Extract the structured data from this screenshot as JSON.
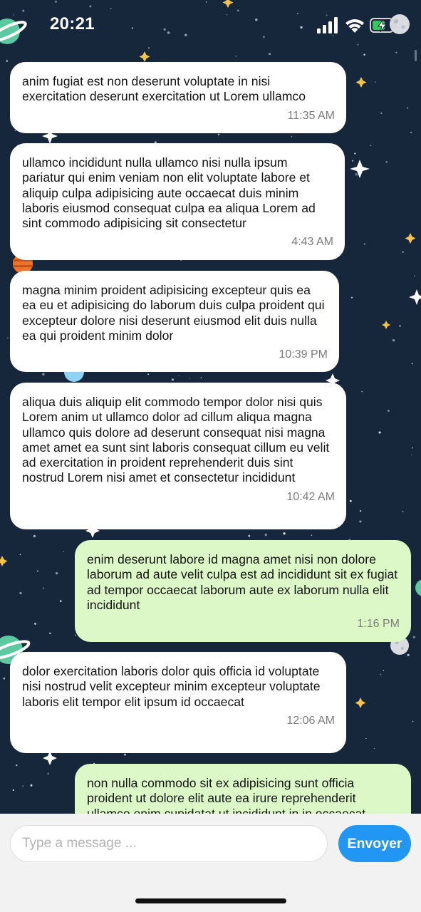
{
  "status_bar": {
    "time": "20:21",
    "icons": [
      "signal-icon",
      "wifi-icon",
      "battery-charging-icon"
    ]
  },
  "chat": {
    "messages": [
      {
        "direction": "received",
        "text": "anim fugiat est non deserunt voluptate in nisi exercitation deserunt exercitation ut Lorem ullamco",
        "time": "11:35 AM"
      },
      {
        "direction": "received",
        "text": "ullamco incididunt nulla ullamco nisi nulla ipsum pariatur qui enim veniam non elit voluptate labore et aliquip culpa adipisicing aute occaecat duis minim laboris eiusmod consequat culpa ea aliqua Lorem ad sint commodo adipisicing sit consectetur",
        "time": "4:43 AM"
      },
      {
        "direction": "received",
        "text": "magna minim proident adipisicing excepteur quis ea ea eu et adipisicing do laborum duis culpa proident qui excepteur dolore nisi deserunt eiusmod elit duis nulla ea qui proident minim dolor",
        "time": "10:39 PM"
      },
      {
        "direction": "received",
        "text": "aliqua duis aliquip elit commodo tempor dolor nisi quis Lorem anim ut ullamco dolor ad cillum aliqua magna ullamco quis dolore ad deserunt consequat nisi magna amet amet ea sunt sint laboris consequat cillum eu velit ad exercitation in proident reprehenderit duis sint nostrud Lorem nisi amet et consectetur incididunt",
        "time": "10:42 AM"
      },
      {
        "direction": "sent",
        "text": "enim deserunt labore id magna amet nisi non dolore laborum ad aute velit culpa est ad incididunt sit ex fugiat ad tempor occaecat laborum aute ex laborum nulla elit incididunt",
        "time": "1:16 PM"
      },
      {
        "direction": "received",
        "text": "dolor exercitation laboris dolor quis officia id voluptate nisi nostrud velit excepteur minim excepteur voluptate laboris elit tempor elit ipsum id occaecat",
        "time": "12:06 AM"
      },
      {
        "direction": "sent",
        "text": "non nulla commodo sit ex adipisicing sunt officia proident ut dolore elit aute ea irure reprehenderit ullamco enim cupidatat ut incididunt in in occaecat",
        "time": ""
      }
    ]
  },
  "composer": {
    "placeholder": "Type a message ...",
    "value": "",
    "send_label": "Envoyer"
  },
  "colors": {
    "background": "#16263b",
    "received_bubble": "#ffffff",
    "sent_bubble": "#dcf8c6",
    "send_button": "#2196f3",
    "timestamp": "#7c7c7c"
  }
}
